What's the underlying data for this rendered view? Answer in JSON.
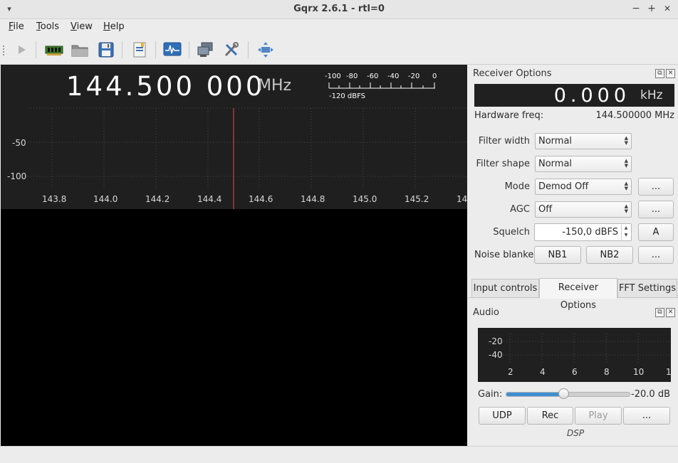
{
  "window": {
    "title": "Gqrx 2.6.1 - rtl=0",
    "min_glyph": "−",
    "max_glyph": "+",
    "close_glyph": "✕",
    "menu_glyph": "▾"
  },
  "menubar": {
    "items": [
      {
        "label": "File",
        "ul": "F",
        "rest": "ile"
      },
      {
        "label": "Tools",
        "ul": "T",
        "rest": "ools"
      },
      {
        "label": "View",
        "ul": "V",
        "rest": "iew"
      },
      {
        "label": "Help",
        "ul": "H",
        "rest": "elp"
      }
    ]
  },
  "toolbar": {
    "icons": [
      "start-dsp-icon",
      "hardware-device-icon",
      "open-folder-icon",
      "save-icon",
      "bookmarks-icon",
      "fft-display-icon",
      "remote-network-icon",
      "settings-tools-icon",
      "fullscreen-icon"
    ]
  },
  "spectrum": {
    "frequency": "144.500 000",
    "unit": "MHz",
    "y_labels": [
      "-50",
      "-100"
    ],
    "x_labels": [
      "143.8",
      "144.0",
      "144.2",
      "144.4",
      "144.6",
      "144.8",
      "145.0",
      "145.2",
      "14"
    ],
    "meter_scale": [
      "-100",
      "-80",
      "-60",
      "-40",
      "-20",
      "0"
    ],
    "meter_value": "-120 dBFS",
    "marker_color": "#e05050"
  },
  "receiver": {
    "title": "Receiver Options",
    "offset_value": "0.000",
    "offset_unit": "kHz",
    "hw_label": "Hardware freq:",
    "hw_value": "144.500000 MHz",
    "filter_width_label": "Filter width",
    "filter_width": "Normal",
    "filter_shape_label": "Filter shape",
    "filter_shape": "Normal",
    "mode_label": "Mode",
    "mode": "Demod Off",
    "agc_label": "AGC",
    "agc": "Off",
    "squelch_label": "Squelch",
    "squelch": "-150,0 dBFS",
    "squelch_auto": "A",
    "nb_label": "Noise blanker",
    "nb1": "NB1",
    "nb2": "NB2",
    "more": "..."
  },
  "tabs": [
    {
      "label": "Input controls"
    },
    {
      "label": "Receiver Options",
      "active": true
    },
    {
      "label": "FFT Settings"
    }
  ],
  "audio": {
    "title": "Audio",
    "y_labels": [
      "-20",
      "-40"
    ],
    "x_labels": [
      "2",
      "4",
      "6",
      "8",
      "10",
      "1"
    ],
    "gain_label": "Gain:",
    "gain_value": "-20.0 dB",
    "gain_fraction": 0.46,
    "udp": "UDP",
    "rec": "Rec",
    "play": "Play",
    "more": "...",
    "dsp": "DSP"
  }
}
